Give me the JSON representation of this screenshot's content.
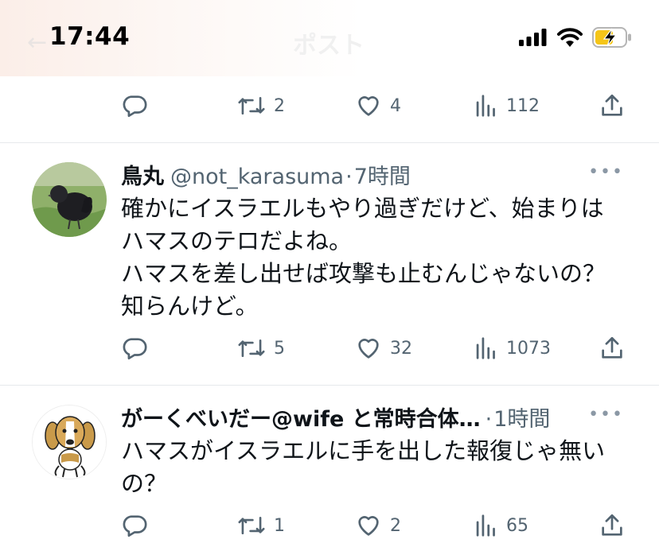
{
  "status_bar": {
    "time": "17:44",
    "nav_title": "ポスト"
  },
  "top_actions": {
    "retweets": "2",
    "likes": "4",
    "views": "112"
  },
  "tweets": [
    {
      "name": "鳥丸",
      "handle": "@not_karasuma",
      "separator": "·",
      "time": "7時間",
      "text": "確かにイスラエルもやり過ぎだけど、始まりは\nハマスのテロだよね。\nハマスを差し出せば攻撃も止むんじゃないの？\n知らんけど。",
      "replies": "",
      "retweets": "5",
      "likes": "32",
      "views": "1073"
    },
    {
      "name": "がーくべいだー@wife と常時合体…",
      "handle": "",
      "separator": "·",
      "time": "1時間",
      "text": "ハマスがイスラエルに手を出した報復じゃ無い\nの？",
      "replies": "",
      "retweets": "1",
      "likes": "2",
      "views": "65"
    }
  ],
  "icons": {
    "reply": "reply-icon",
    "retweet": "retweet-icon",
    "like": "heart-icon",
    "views": "views-icon",
    "share": "share-icon",
    "more": "more-icon"
  },
  "colors": {
    "text": "#0f1419",
    "secondary": "#536471",
    "divider": "#e6e9ec",
    "battery": "#f5c518"
  }
}
